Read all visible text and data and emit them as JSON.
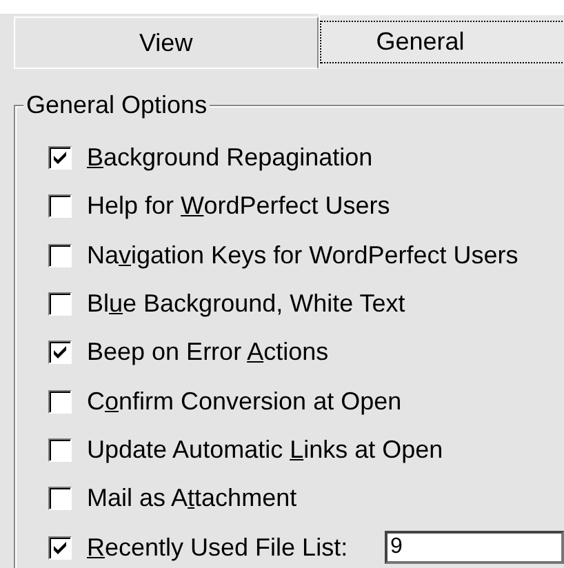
{
  "tabs": [
    {
      "label": "View",
      "selected": false
    },
    {
      "label": "General",
      "selected": true
    }
  ],
  "group": {
    "title": "General Options",
    "options": [
      {
        "key": "B",
        "after": "ackground Repagination",
        "checked": true
      },
      {
        "before": "Help for ",
        "key": "W",
        "after": "ordPerfect Users",
        "checked": false
      },
      {
        "before": "Na",
        "key": "v",
        "after": "igation Keys for WordPerfect Users",
        "checked": false
      },
      {
        "before": "Bl",
        "key": "u",
        "after": "e Background, White Text",
        "checked": false
      },
      {
        "before": "Beep on Error ",
        "key": "A",
        "after": "ctions",
        "checked": true
      },
      {
        "before": "C",
        "key": "o",
        "after": "nfirm Conversion at Open",
        "checked": false
      },
      {
        "before": "Update Automatic ",
        "key": "L",
        "after": "inks at Open",
        "checked": false
      },
      {
        "before": "Mail as A",
        "key": "t",
        "after": "tachment",
        "checked": false
      },
      {
        "key": "R",
        "after": "ecently Used File List:",
        "checked": true,
        "value": "9"
      }
    ]
  }
}
